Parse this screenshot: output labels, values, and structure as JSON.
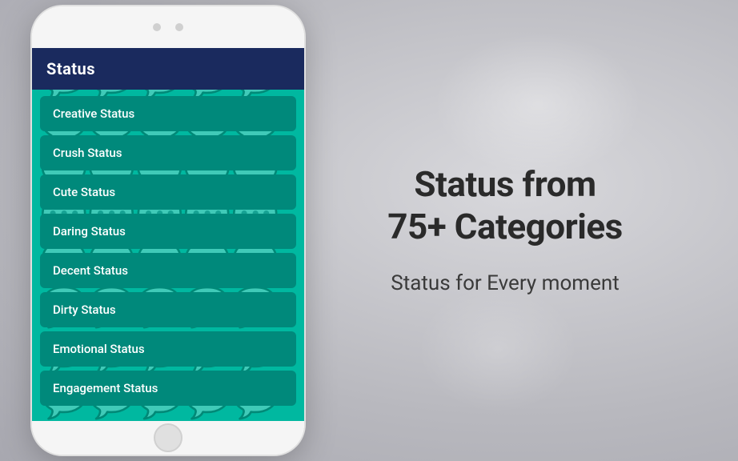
{
  "app": {
    "header_title": "Status"
  },
  "list_items": [
    {
      "label": "Creative Status",
      "id": "creative"
    },
    {
      "label": "Crush Status",
      "id": "crush"
    },
    {
      "label": "Cute Status",
      "id": "cute"
    },
    {
      "label": "Daring Status",
      "id": "daring"
    },
    {
      "label": "Decent Status",
      "id": "decent"
    },
    {
      "label": "Dirty Status",
      "id": "dirty"
    },
    {
      "label": "Emotional Status",
      "id": "emotional"
    },
    {
      "label": "Engagement Status",
      "id": "engagement"
    }
  ],
  "right": {
    "main_heading": "Status from\n75+ Categories",
    "sub_heading": "Status for Every moment"
  },
  "colors": {
    "header_bg": "#1a2a5e",
    "list_bg": "#00897b",
    "screen_bg": "#00b8a0"
  }
}
